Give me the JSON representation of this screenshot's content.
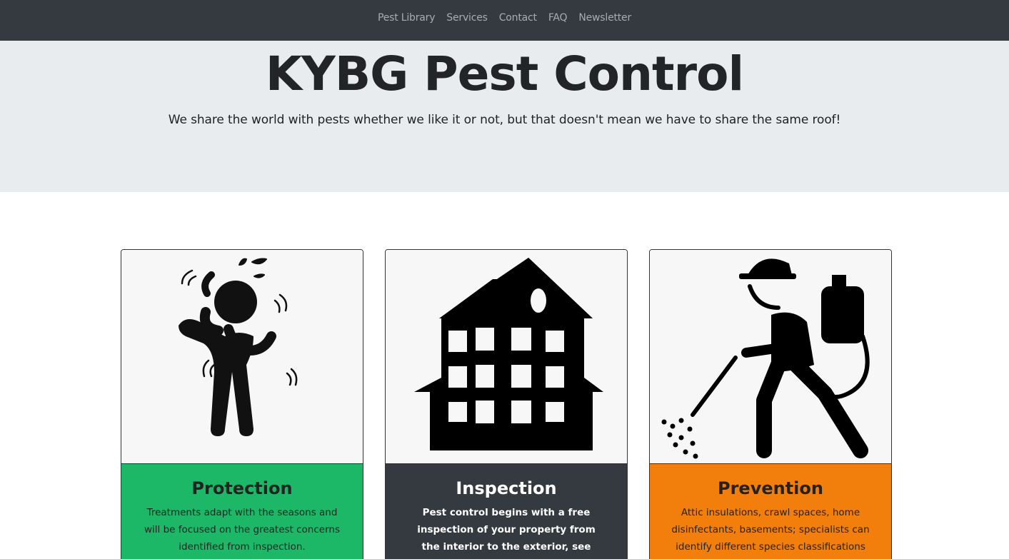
{
  "nav": {
    "items": [
      {
        "label": "Pest Library"
      },
      {
        "label": "Services"
      },
      {
        "label": "Contact"
      },
      {
        "label": "FAQ"
      },
      {
        "label": "Newsletter"
      }
    ]
  },
  "hero": {
    "title": "KYBG Pest Control",
    "subtitle": "We share the world with pests whether we like it or not, but that doesn't mean we have to share the same roof!"
  },
  "cards": [
    {
      "title": "Protection",
      "text": "Treatments adapt with the seasons and will be focused on the greatest concerns identified from inspection.",
      "icon": "itchy-person-icon",
      "color": "#1cb868"
    },
    {
      "title": "Inspection",
      "text": "Pest control begins with a free inspection of your property from the interior to the exterior, see what kind of bug activity",
      "icon": "house-icon",
      "color": "#343a40"
    },
    {
      "title": "Prevention",
      "text": "Attic insulations, crawl spaces, home disinfectants, basements; specialists can identify different species classifications and",
      "icon": "exterminator-spraying-icon",
      "color": "#f27f0c"
    }
  ]
}
